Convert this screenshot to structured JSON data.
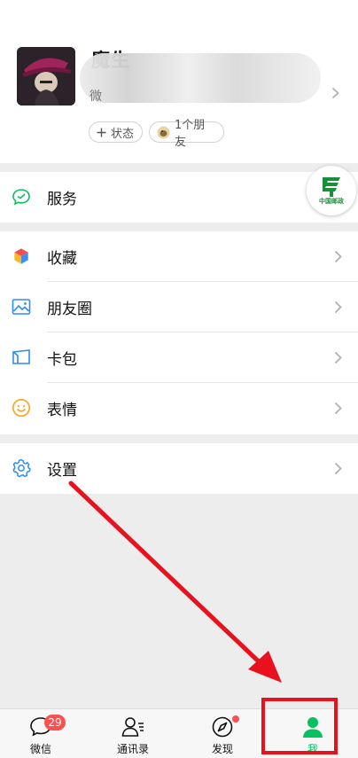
{
  "profile": {
    "nickname": "魔生",
    "wechat_id_prefix": "微",
    "status_chip": "状态",
    "friends_chip": "1个朋友"
  },
  "floating_badge": {
    "text": "中国邮政"
  },
  "menu": {
    "services": "服务",
    "favorites": "收藏",
    "moments": "朋友圈",
    "cards": "卡包",
    "stickers": "表情",
    "settings": "设置"
  },
  "tabbar": {
    "chats": {
      "label": "微信",
      "badge": "29"
    },
    "contacts": {
      "label": "通讯录"
    },
    "discover": {
      "label": "发现"
    },
    "me": {
      "label": "我"
    }
  },
  "colors": {
    "accent_green": "#07c160",
    "badge_red": "#fa5151",
    "annotation_red": "#e8121e",
    "background": "#ededed"
  }
}
